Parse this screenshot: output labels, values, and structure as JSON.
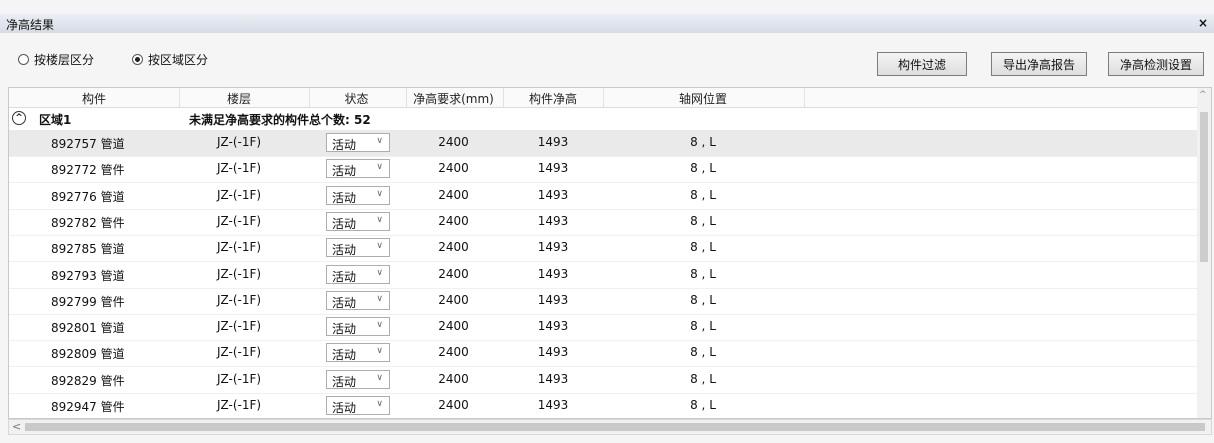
{
  "window": {
    "title": "净高结果",
    "close_label": "×"
  },
  "options": {
    "radio_floor": "按楼层区分",
    "radio_region": "按区域区分",
    "selected": "region"
  },
  "buttons": {
    "filter": "构件过滤",
    "export": "导出净高报告",
    "settings": "净高检测设置"
  },
  "table": {
    "headers": [
      "构件",
      "楼层",
      "状态",
      "净高要求(mm)",
      "构件净高",
      "轴网位置"
    ],
    "group": {
      "label": "区域1",
      "summary": "未满足净高要求的构件总个数: 52",
      "toggle_icon": "chevron-up-icon"
    },
    "rows": [
      {
        "component": "892757 管道",
        "floor": "JZ-(-1F)",
        "status": "活动",
        "required": "2400",
        "height": "1493",
        "axis": "8 , L"
      },
      {
        "component": "892772 管件",
        "floor": "JZ-(-1F)",
        "status": "活动",
        "required": "2400",
        "height": "1493",
        "axis": "8 , L"
      },
      {
        "component": "892776 管道",
        "floor": "JZ-(-1F)",
        "status": "活动",
        "required": "2400",
        "height": "1493",
        "axis": "8 , L"
      },
      {
        "component": "892782 管件",
        "floor": "JZ-(-1F)",
        "status": "活动",
        "required": "2400",
        "height": "1493",
        "axis": "8 , L"
      },
      {
        "component": "892785 管道",
        "floor": "JZ-(-1F)",
        "status": "活动",
        "required": "2400",
        "height": "1493",
        "axis": "8 , L"
      },
      {
        "component": "892793 管道",
        "floor": "JZ-(-1F)",
        "status": "活动",
        "required": "2400",
        "height": "1493",
        "axis": "8 , L"
      },
      {
        "component": "892799 管件",
        "floor": "JZ-(-1F)",
        "status": "活动",
        "required": "2400",
        "height": "1493",
        "axis": "8 , L"
      },
      {
        "component": "892801 管道",
        "floor": "JZ-(-1F)",
        "status": "活动",
        "required": "2400",
        "height": "1493",
        "axis": "8 , L"
      },
      {
        "component": "892809 管道",
        "floor": "JZ-(-1F)",
        "status": "活动",
        "required": "2400",
        "height": "1493",
        "axis": "8 , L"
      },
      {
        "component": "892829 管件",
        "floor": "JZ-(-1F)",
        "status": "活动",
        "required": "2400",
        "height": "1493",
        "axis": "8 , L"
      },
      {
        "component": "892947 管件",
        "floor": "JZ-(-1F)",
        "status": "活动",
        "required": "2400",
        "height": "1493",
        "axis": "8 , L"
      }
    ]
  }
}
